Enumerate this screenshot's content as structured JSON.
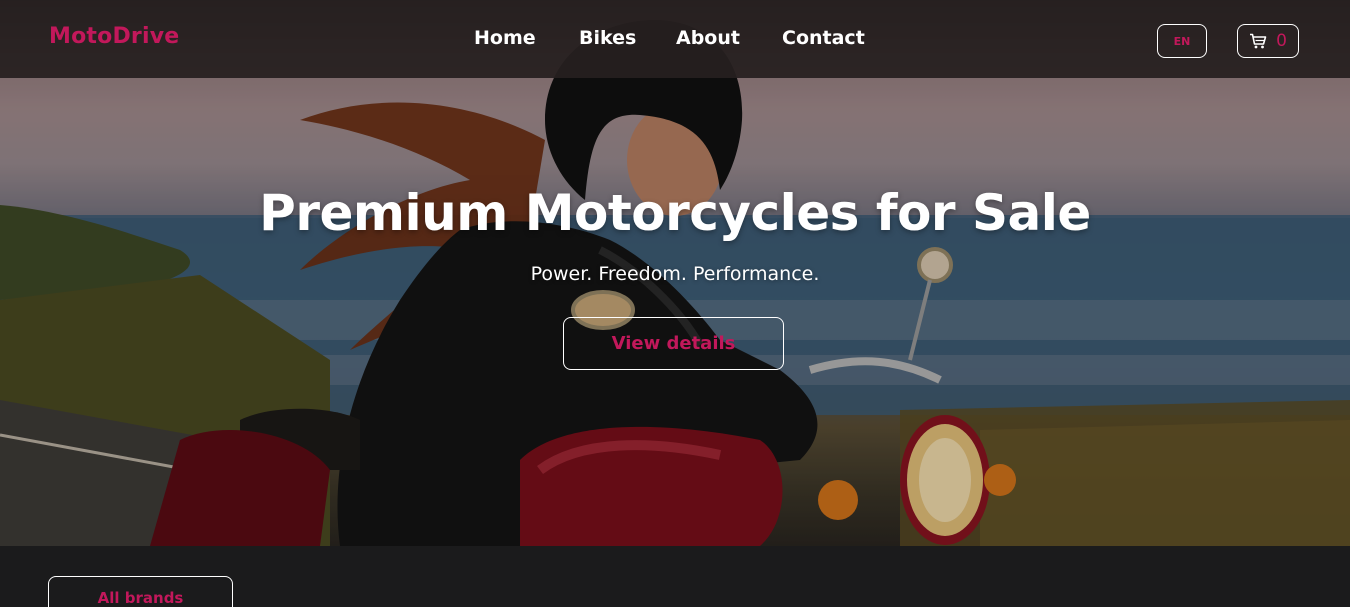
{
  "brand": {
    "logo": "MotoDrive",
    "accent_color": "#c2185b"
  },
  "nav": {
    "links": [
      {
        "label": "Home"
      },
      {
        "label": "Bikes"
      },
      {
        "label": "About"
      },
      {
        "label": "Contact"
      }
    ],
    "language": "EN",
    "cart": {
      "icon": "cart-icon",
      "count": "0"
    }
  },
  "hero": {
    "title": "Premium Motorcycles for Sale",
    "subtitle": "Power. Freedom. Performance.",
    "cta_label": "View details",
    "image": "hero-image"
  },
  "filters": {
    "brand_select": "All brands"
  }
}
